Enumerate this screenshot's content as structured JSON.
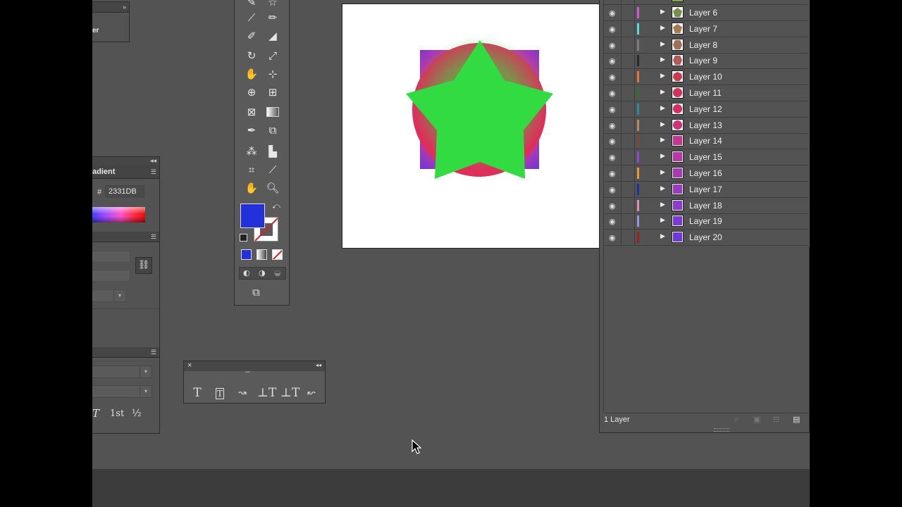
{
  "left_panel": {
    "label": "er"
  },
  "gradient_panel": {
    "tab_label": "adient",
    "hash_label": "#",
    "hex_value": "2331DB"
  },
  "char_panel": {
    "glyph_t": "T",
    "superscript": "1st",
    "fraction": "½"
  },
  "tools_panel": {
    "fill_color": "#2331db",
    "icons": [
      "pen-icon",
      "star-icon",
      "paintbrush-icon",
      "pencil-icon",
      "blob-brush-icon",
      "eraser-icon",
      "rotate-icon",
      "scale-icon",
      "warp-icon",
      "free-transform-icon",
      "shape-builder-icon",
      "perspective-grid-icon",
      "mesh-icon",
      "gradient-icon",
      "eyedropper-icon",
      "blend-icon",
      "symbol-sprayer-icon",
      "column-graph-icon",
      "artboard-icon",
      "slice-icon",
      "hand-icon",
      "zoom-icon"
    ]
  },
  "type_panel": {
    "close": "×",
    "collapse": "◂◂",
    "grip": "••••••••"
  },
  "layers_panel": {
    "layers": [
      {
        "name": "Layer 6",
        "color": "#d257d8",
        "thumb": "#768f4b",
        "shape": "pentagon"
      },
      {
        "name": "Layer 7",
        "color": "#57d7e3",
        "thumb": "#a8784f",
        "shape": "pentagon"
      },
      {
        "name": "Layer 8",
        "color": "#7d7d7d",
        "thumb": "#a46f58",
        "shape": "hexagon"
      },
      {
        "name": "Layer 9",
        "color": "#2a2a2a",
        "thumb": "#b25a57",
        "shape": "hexagon"
      },
      {
        "name": "Layer 10",
        "color": "#e6762f",
        "thumb": "#cc3b4c",
        "shape": "heptagon"
      },
      {
        "name": "Layer 11",
        "color": "#2f6f2f",
        "thumb": "#d6315a",
        "shape": "circle"
      },
      {
        "name": "Layer 12",
        "color": "#2c8e92",
        "thumb": "#d62e63",
        "shape": "circle"
      },
      {
        "name": "Layer 13",
        "color": "#b58961",
        "thumb": "#cf317a",
        "shape": "circle"
      },
      {
        "name": "Layer 14",
        "color": "#7a4a36",
        "thumb": "#c53592",
        "shape": "square"
      },
      {
        "name": "Layer 15",
        "color": "#8c47d8",
        "thumb": "#b637a6",
        "shape": "square"
      },
      {
        "name": "Layer 16",
        "color": "#e69a2f",
        "thumb": "#a73bb4",
        "shape": "square"
      },
      {
        "name": "Layer 17",
        "color": "#1e2e9c",
        "thumb": "#983dc0",
        "shape": "square"
      },
      {
        "name": "Layer 18",
        "color": "#e08ab9",
        "thumb": "#8a3ccd",
        "shape": "square"
      },
      {
        "name": "Layer 19",
        "color": "#8b9ae0",
        "thumb": "#7b3ad6",
        "shape": "square"
      },
      {
        "name": "Layer 20",
        "color": "#a51e1e",
        "thumb": "#6c39dc",
        "shape": "square"
      }
    ],
    "footer_count": "1 Layer"
  }
}
